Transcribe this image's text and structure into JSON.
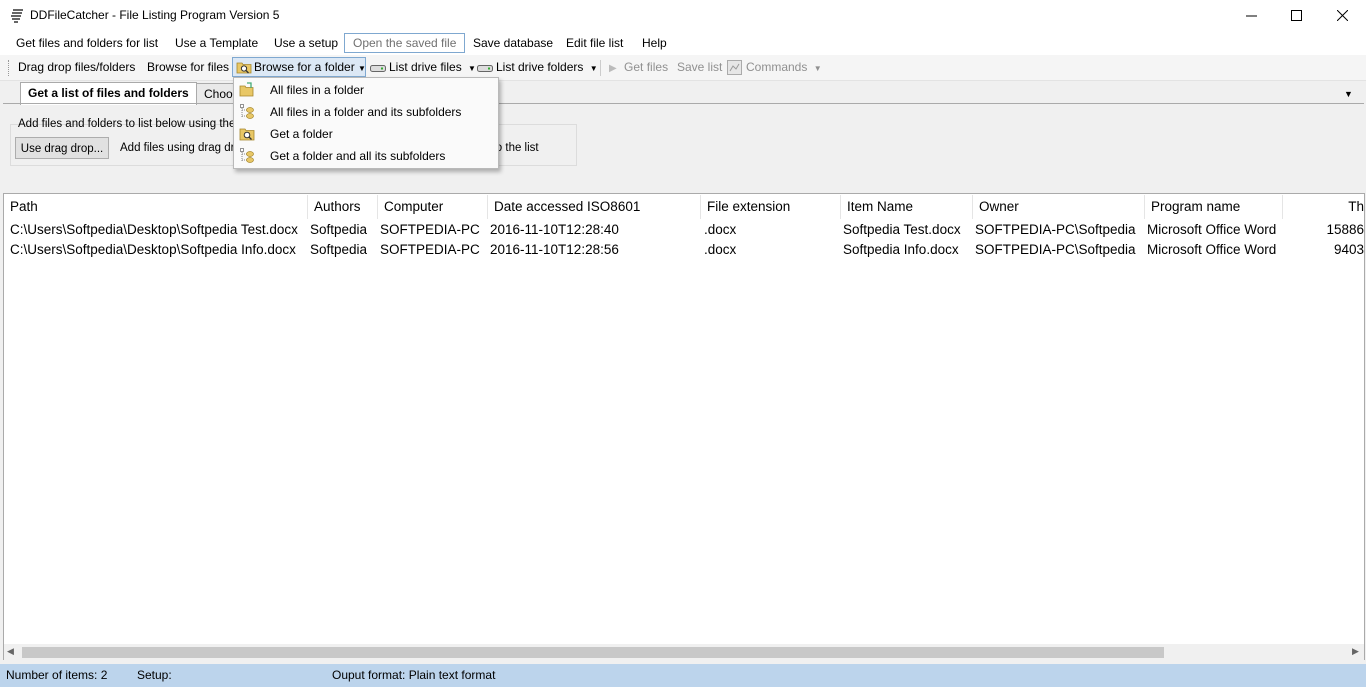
{
  "window": {
    "title": "DDFileCatcher - File Listing Program Version 5",
    "controls": {
      "minimize": "—",
      "maximize": "☐",
      "close": "✕"
    }
  },
  "menu": [
    "Get files and folders for list",
    "Use a Template",
    "Use a setup",
    "Open the saved file",
    "Save database",
    "Edit file list",
    "Help"
  ],
  "toolbar": {
    "drag_drop": "Drag drop files/folders",
    "browse_files": "Browse for files",
    "browse_folder": "Browse for a folder",
    "list_drive_files": "List drive files",
    "list_drive_folders": "List drive folders",
    "get_files": "Get files",
    "save_list": "Save list",
    "commands": "Commands"
  },
  "tabs": {
    "active": "Get a list of files and folders",
    "second": "Choo"
  },
  "panel": {
    "group_text": "Add files and folders to list below using these b",
    "drag_button": "Use drag drop...",
    "drag_hint": "Add files using drag drop",
    "list_suffix": "d to the list"
  },
  "dropdown": {
    "items": [
      "All files in a folder",
      "All files in a folder and its subfolders",
      "Get a folder",
      "Get a folder and all its subfolders"
    ]
  },
  "table": {
    "columns": [
      "Path",
      "Authors",
      "Computer",
      "Date accessed ISO8601",
      "File extension",
      "Item Name",
      "Owner",
      "Program name",
      "Th"
    ],
    "rows": [
      [
        "C:\\Users\\Softpedia\\Desktop\\Softpedia Test.docx",
        "Softpedia",
        "SOFTPEDIA-PC",
        "2016-11-10T12:28:40",
        ".docx",
        "Softpedia Test.docx",
        "SOFTPEDIA-PC\\Softpedia",
        "Microsoft Office Word",
        "15886"
      ],
      [
        "C:\\Users\\Softpedia\\Desktop\\Softpedia Info.docx",
        "Softpedia",
        "SOFTPEDIA-PC",
        "2016-11-10T12:28:56",
        ".docx",
        "Softpedia Info.docx",
        "SOFTPEDIA-PC\\Softpedia",
        "Microsoft Office Word",
        "9403"
      ]
    ]
  },
  "status": {
    "items": "Number of items: 2",
    "setup": "Setup:",
    "format": "Ouput format: Plain text format"
  },
  "colors": {
    "status_bar": "#bcd4ec",
    "menu_highlight_border": "#7fa8d0"
  }
}
